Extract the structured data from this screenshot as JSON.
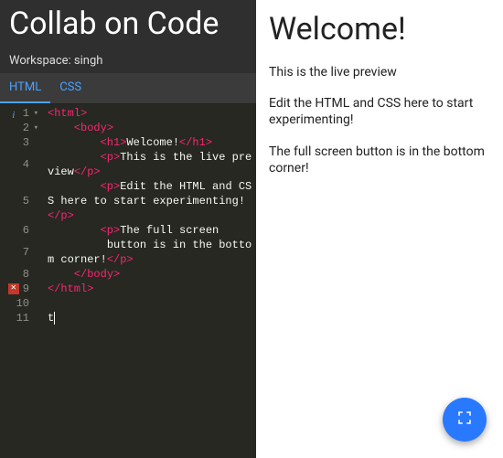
{
  "app": {
    "title": "Collab on Code"
  },
  "workspace": {
    "label": "Workspace: singh"
  },
  "tabs": [
    "HTML",
    "CSS"
  ],
  "active_tab": 0,
  "editor": {
    "gutter_markers": {
      "1": "info",
      "9": "error"
    },
    "fold_markers": [
      1,
      2
    ],
    "lines": [
      {
        "n": 1,
        "tokens": [
          [
            "tag",
            "<html>"
          ]
        ]
      },
      {
        "n": 2,
        "tokens": [
          [
            "txt",
            "    "
          ],
          [
            "tag",
            "<body>"
          ]
        ]
      },
      {
        "n": 3,
        "tokens": [
          [
            "txt",
            "        "
          ],
          [
            "tag",
            "<h1>"
          ],
          [
            "txt",
            "Welcome!"
          ],
          [
            "tag",
            "</h1>"
          ]
        ]
      },
      {
        "n": 4,
        "wrap": true,
        "tokens": [
          [
            "txt",
            "        "
          ],
          [
            "tag",
            "<p>"
          ],
          [
            "txt",
            "This is the live preview"
          ],
          [
            "tag",
            "</p>"
          ]
        ]
      },
      {
        "n": 5,
        "wrap": true,
        "tokens": [
          [
            "txt",
            "        "
          ],
          [
            "tag",
            "<p>"
          ],
          [
            "txt",
            "Edit the HTML and CSS here to start experimenting!"
          ],
          [
            "tag",
            "</p>"
          ]
        ]
      },
      {
        "n": 6,
        "tokens": [
          [
            "txt",
            "        "
          ],
          [
            "tag",
            "<p>"
          ],
          [
            "txt",
            "The full screen "
          ]
        ]
      },
      {
        "n": 7,
        "wrap": true,
        "tokens": [
          [
            "txt",
            "         button is in the bottom corner!"
          ],
          [
            "tag",
            "</p>"
          ]
        ]
      },
      {
        "n": 8,
        "tokens": [
          [
            "txt",
            "    "
          ],
          [
            "tag",
            "</body>"
          ]
        ]
      },
      {
        "n": 9,
        "tokens": [
          [
            "tag",
            "</html>"
          ]
        ]
      },
      {
        "n": 10,
        "tokens": [
          [
            "txt",
            ""
          ]
        ]
      },
      {
        "n": 11,
        "tokens": [
          [
            "txt",
            "t"
          ]
        ],
        "cursor": true
      }
    ]
  },
  "preview": {
    "heading": "Welcome!",
    "paragraphs": [
      "This is the live preview",
      "Edit the HTML and CSS here to start experimenting!",
      "The full screen button is in the bottom corner!"
    ]
  },
  "fab": {
    "name": "fullscreen"
  },
  "colors": {
    "accent": "#2979ff",
    "tab": "#4aa3ff",
    "tag": "#f92672"
  }
}
